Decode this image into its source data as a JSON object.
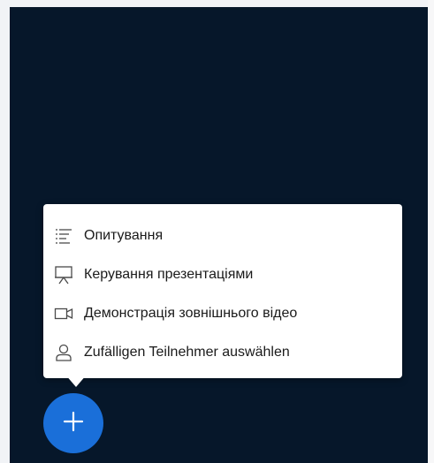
{
  "menu": {
    "items": [
      {
        "icon": "polls-icon",
        "label": "Опитування"
      },
      {
        "icon": "presentation-icon",
        "label": "Керування презентаціями"
      },
      {
        "icon": "external-video-icon",
        "label": "Демонстрація зовнішнього відео"
      },
      {
        "icon": "user-icon",
        "label": "Zufälligen Teilnehmer auswählen"
      }
    ]
  },
  "fab": {
    "icon": "plus-icon"
  },
  "colors": {
    "background_dark": "#06172a",
    "fab": "#1a6fd9",
    "menu_bg": "#ffffff",
    "icon": "#4a4a4a"
  }
}
